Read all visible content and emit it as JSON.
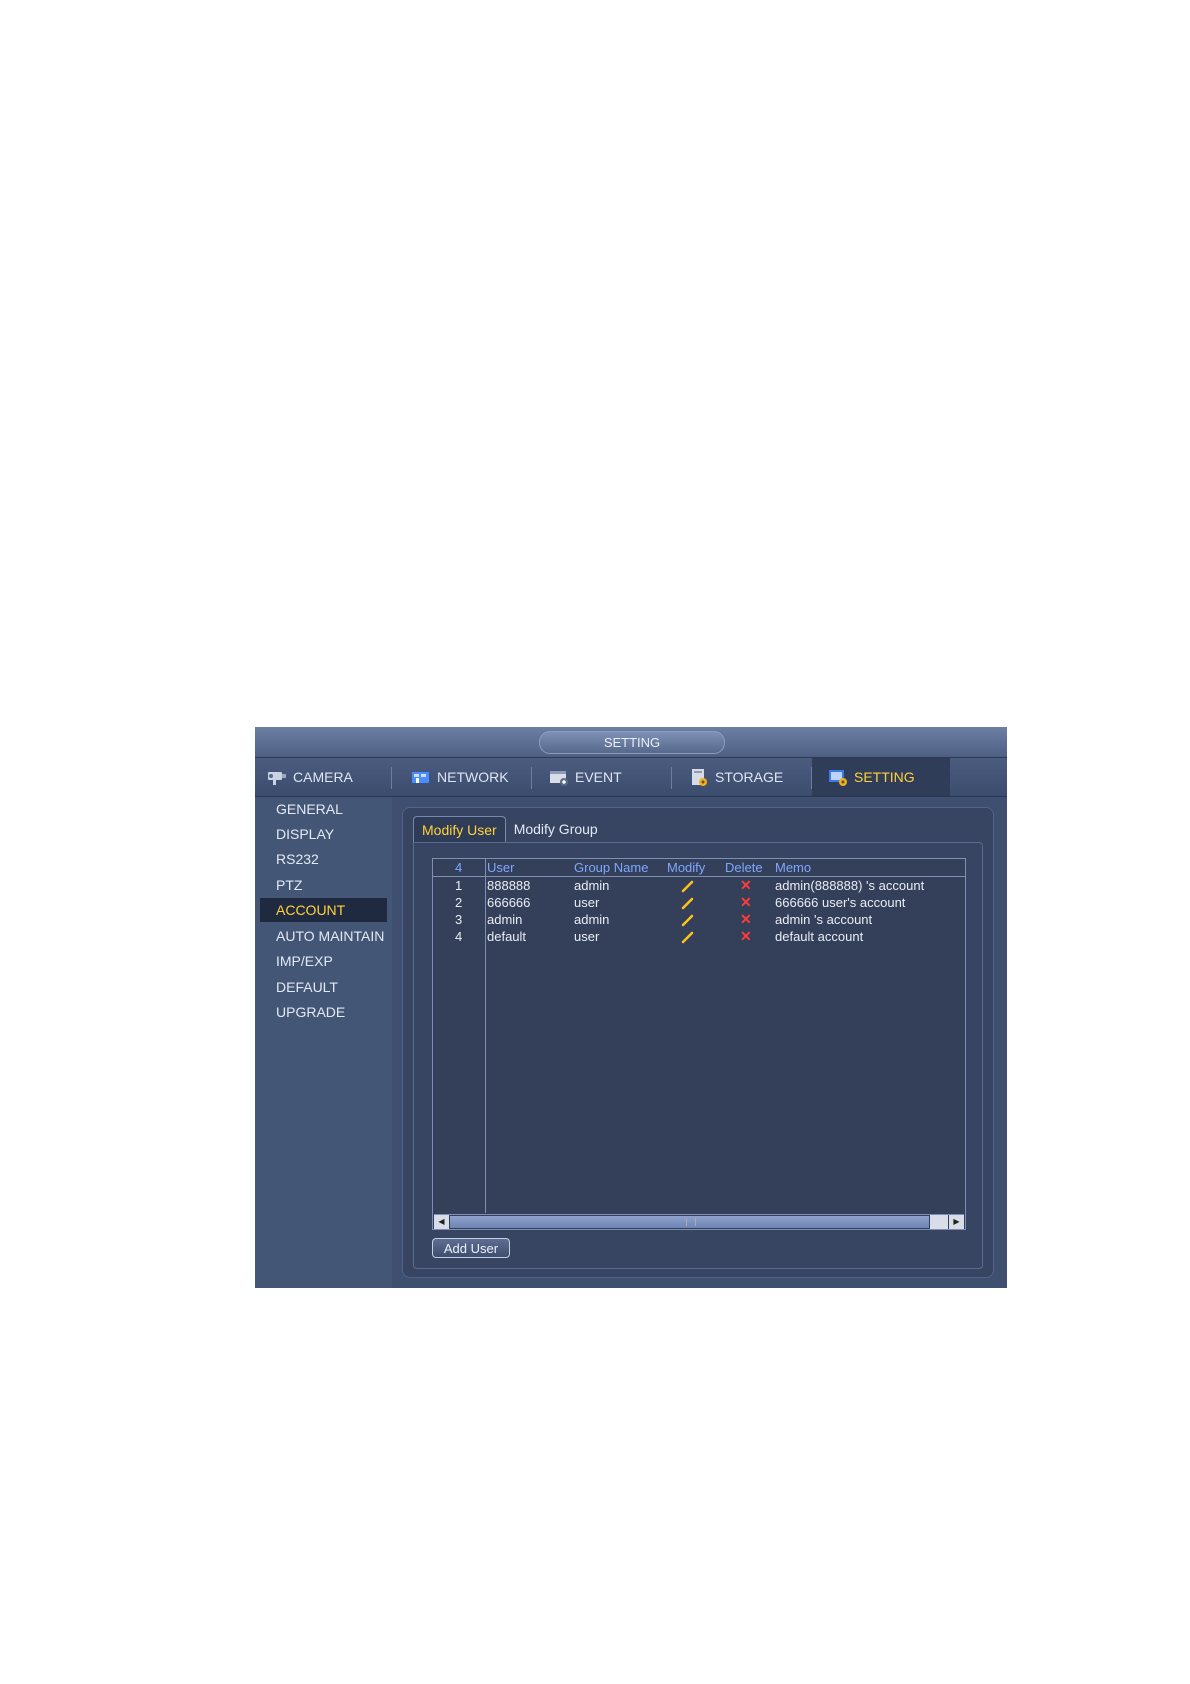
{
  "window": {
    "title": "SETTING"
  },
  "tabs": [
    {
      "label": "CAMERA",
      "icon": "camera-icon"
    },
    {
      "label": "NETWORK",
      "icon": "network-icon"
    },
    {
      "label": "EVENT",
      "icon": "event-icon"
    },
    {
      "label": "STORAGE",
      "icon": "storage-icon"
    },
    {
      "label": "SETTING",
      "icon": "setting-icon",
      "active": true
    }
  ],
  "sidebar": {
    "items": [
      {
        "label": "GENERAL"
      },
      {
        "label": "DISPLAY"
      },
      {
        "label": "RS232"
      },
      {
        "label": "PTZ"
      },
      {
        "label": "ACCOUNT",
        "active": true
      },
      {
        "label": "AUTO MAINTAIN"
      },
      {
        "label": "IMP/EXP"
      },
      {
        "label": "DEFAULT"
      },
      {
        "label": "UPGRADE"
      }
    ]
  },
  "inner_tabs": [
    {
      "label": "Modify User",
      "active": true
    },
    {
      "label": "Modify Group"
    }
  ],
  "table": {
    "headers": {
      "count": "4",
      "user": "User",
      "group": "Group Name",
      "modify": "Modify",
      "delete": "Delete",
      "memo": "Memo"
    },
    "rows": [
      {
        "index": "1",
        "user": "888888",
        "group": "admin",
        "memo": "admin(888888) 's account"
      },
      {
        "index": "2",
        "user": "666666",
        "group": "user",
        "memo": "666666 user's account"
      },
      {
        "index": "3",
        "user": "admin",
        "group": "admin",
        "memo": "admin 's account"
      },
      {
        "index": "4",
        "user": "default",
        "group": "user",
        "memo": "default account"
      }
    ]
  },
  "buttons": {
    "add_user": "Add User"
  },
  "colors": {
    "accent": "#ffd23c",
    "header_text": "#7ea6ff",
    "delete": "#ff3b3b",
    "modify": "#ffc21a"
  }
}
